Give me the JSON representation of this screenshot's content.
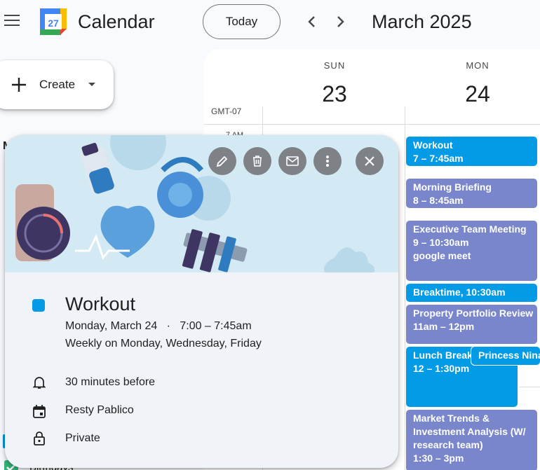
{
  "header": {
    "app_title": "Calendar",
    "logo_day": "27",
    "today_label": "Today",
    "month_title": "March 2025",
    "menu_icon": "hamburger-menu-icon",
    "prev_icon": "chevron-left-icon",
    "next_icon": "chevron-right-icon"
  },
  "sidebar": {
    "create_label": "Create",
    "calendar_item_label": "Birthdays",
    "calendar_item_color": "#33b679"
  },
  "grid": {
    "timezone": "GMT-07",
    "time_label": "7 AM",
    "days": [
      {
        "name": "SUN",
        "number": "23"
      },
      {
        "name": "MON",
        "number": "24"
      }
    ]
  },
  "events": [
    {
      "title": "Workout",
      "time": "7 – 7:45am",
      "color": "#039be5"
    },
    {
      "title": "Morning Briefing",
      "time": "8 – 8:45am",
      "color": "#7986cb"
    },
    {
      "title": "Executive Team Meeting",
      "time": "9 – 10:30am",
      "location": "google meet",
      "color": "#7986cb"
    },
    {
      "title": "Breaktime, 10:30am",
      "color": "#039be5"
    },
    {
      "title": "Property Portfolio Review",
      "time": "11am – 12pm",
      "color": "#7986cb"
    },
    {
      "title": "Lunch Break",
      "time": "12 – 1:30pm",
      "color": "#039be5"
    },
    {
      "title": "Princess Nina",
      "color": "#039be5"
    },
    {
      "title": "Market Trends & Investment Analysis (W/ research team)",
      "time": "1:30 – 3pm",
      "color": "#7986cb"
    }
  ],
  "popup": {
    "title": "Workout",
    "date": "Monday, March 24",
    "time": "7:00 – 7:45am",
    "recurrence": "Weekly on Monday, Wednesday, Friday",
    "reminder": "30 minutes before",
    "organizer": "Resty Pablico",
    "visibility": "Private",
    "color": "#039be5",
    "actions": [
      "edit-icon",
      "delete-icon",
      "email-icon",
      "more-options-icon",
      "close-icon"
    ]
  }
}
